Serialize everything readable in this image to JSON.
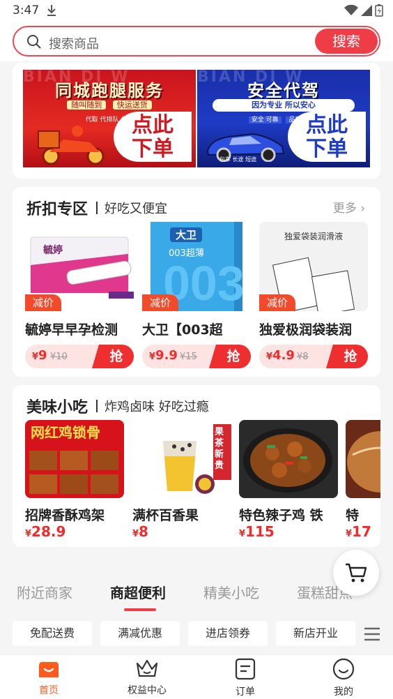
{
  "status_bar": {
    "time": "3:47"
  },
  "search": {
    "placeholder": "搜索商品",
    "button_label": "搜索"
  },
  "banners": [
    {
      "title": "同城跑腿服务",
      "subtitle_chips": [
        "随叫随到",
        "快运送货"
      ],
      "tags": "代取 代排队 代买",
      "cta_line1": "点此",
      "cta_line2": "下单",
      "watermark": "BIAN DI W",
      "color": "#d8161f"
    },
    {
      "title": "安全代驾",
      "subtitle": "因为专业 所以安心",
      "tags": [
        "安全 可靠",
        "品质 服务"
      ],
      "footer": "包车 长途 短途",
      "cta_line1": "点此",
      "cta_line2": "下单",
      "watermark": "BIAN DI W",
      "color": "#1e3bc5"
    }
  ],
  "discount_section": {
    "title": "折扣专区",
    "subtitle": "好吃又便宜",
    "more_label": "更多",
    "badge_label": "减价",
    "grab_label": "抢",
    "currency": "¥",
    "items": [
      {
        "name": "毓婷早早孕检测",
        "price": "9",
        "original_price": "¥10",
        "image_text": "毓婷"
      },
      {
        "name": "大卫【003超",
        "price": "9.9",
        "original_price": "¥15",
        "image_text": "大卫",
        "image_subtext": "003超薄"
      },
      {
        "name": "独爱极润袋装润",
        "price": "4.9",
        "original_price": "¥8",
        "image_text": "独爱袋装润滑液"
      }
    ]
  },
  "snack_section": {
    "title": "美味小吃",
    "subtitle": "炸鸡卤味 好吃过瘾",
    "currency": "¥",
    "items": [
      {
        "name": "招牌香酥鸡架",
        "price": "28.9",
        "image_text": "网红鸡锁骨"
      },
      {
        "name": "满杯百香果",
        "price": "8",
        "image_text": "果茶新贵"
      },
      {
        "name": "特色辣子鸡 铁",
        "price": "115"
      },
      {
        "name": "特",
        "price": "17"
      }
    ]
  },
  "category_tabs": [
    {
      "label": "附近商家",
      "active": false
    },
    {
      "label": "商超便利",
      "active": true
    },
    {
      "label": "精美小吃",
      "active": false
    },
    {
      "label": "蛋糕甜点",
      "active": false
    }
  ],
  "filter_chips": [
    "免配送费",
    "满减优惠",
    "进店领券",
    "新店开业"
  ],
  "tab_bar": [
    {
      "label": "首页",
      "icon": "home-icon",
      "active": true
    },
    {
      "label": "权益中心",
      "icon": "crown-icon",
      "active": false
    },
    {
      "label": "订单",
      "icon": "order-icon",
      "active": false
    },
    {
      "label": "我的",
      "icon": "profile-icon",
      "active": false
    }
  ],
  "colors": {
    "accent": "#ef3d47",
    "price": "#f12a2a",
    "tab_active": "#ff5a1e"
  }
}
